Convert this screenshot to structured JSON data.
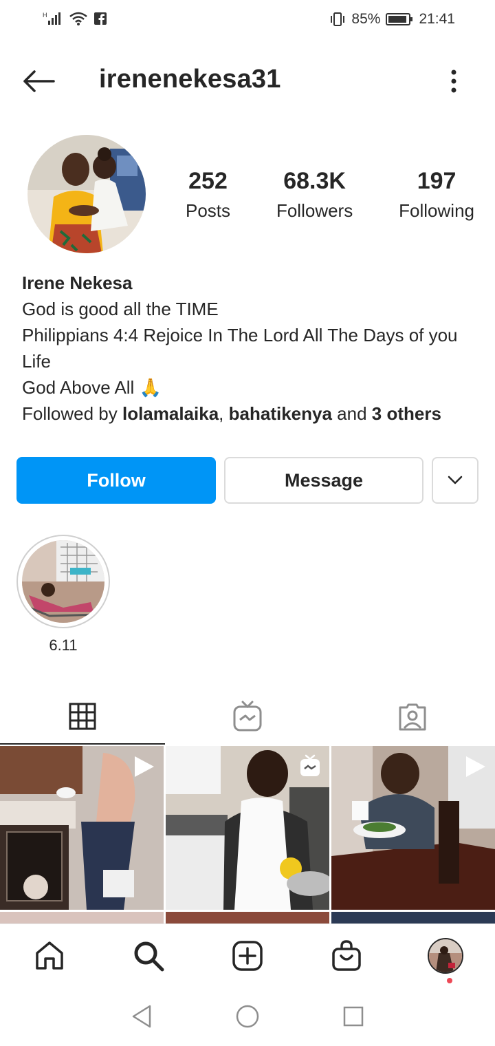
{
  "status_bar": {
    "signal_icon": "signal-icon",
    "wifi_icon": "wifi-icon",
    "facebook_icon": "facebook-icon",
    "vibrate_icon": "vibrate-icon",
    "battery_percent": "85%",
    "time": "21:41"
  },
  "header": {
    "username": "irenenekesa31"
  },
  "profile": {
    "stats": [
      {
        "value": "252",
        "label": "Posts"
      },
      {
        "value": "68.3K",
        "label": "Followers"
      },
      {
        "value": "197",
        "label": "Following"
      }
    ],
    "bio": {
      "name": "Irene Nekesa",
      "lines": [
        "God is good all the TIME",
        "Philippians 4:4 Rejoice In The Lord All The Days of you Life",
        "God Above All 🙏"
      ],
      "followed_by_prefix": "Followed by",
      "followed_by_user1": "lolamalaika",
      "followed_by_sep": ",",
      "followed_by_user2": "bahatikenya",
      "followed_by_and": "and",
      "followed_by_others": "3 others"
    }
  },
  "actions": {
    "follow_label": "Follow",
    "message_label": "Message"
  },
  "highlights": [
    {
      "label": "6.11"
    }
  ],
  "tabs": [
    {
      "icon": "grid-icon",
      "active": true
    },
    {
      "icon": "igtv-icon",
      "active": false
    },
    {
      "icon": "tagged-icon",
      "active": false
    }
  ],
  "posts": [
    {
      "type": "video",
      "icon": "play-icon"
    },
    {
      "type": "igtv",
      "icon": "igtv-icon"
    },
    {
      "type": "video",
      "icon": "play-icon"
    }
  ],
  "bottom_nav": [
    {
      "icon": "home-icon"
    },
    {
      "icon": "search-icon"
    },
    {
      "icon": "add-post-icon"
    },
    {
      "icon": "shop-icon"
    },
    {
      "icon": "profile-avatar"
    }
  ],
  "colors": {
    "accent": "#0095f6",
    "text": "#262626",
    "border": "#dbdbdb",
    "notification": "#ed4956"
  }
}
